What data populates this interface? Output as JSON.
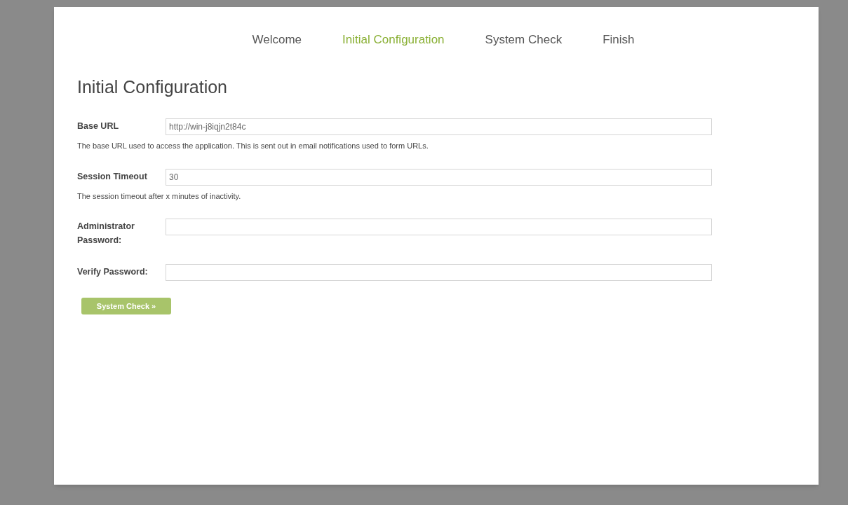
{
  "steps": [
    {
      "label": "Welcome",
      "selected": false
    },
    {
      "label": "Initial Configuration",
      "selected": true
    },
    {
      "label": "System Check",
      "selected": false
    },
    {
      "label": "Finish",
      "selected": false
    }
  ],
  "heading": "Initial Configuration",
  "fields": [
    {
      "label": "Base URL",
      "value": "http://win-j8iqjn2t84c",
      "help": "The base URL used to access the application. This is sent out in email notifications used to form URLs."
    },
    {
      "label": "Session Timeout",
      "value": "30",
      "help": "The session timeout after x minutes of inactivity."
    },
    {
      "label": "Administrator Password:"
    },
    {
      "label": "Verify Password:"
    }
  ],
  "button": "System Check »"
}
